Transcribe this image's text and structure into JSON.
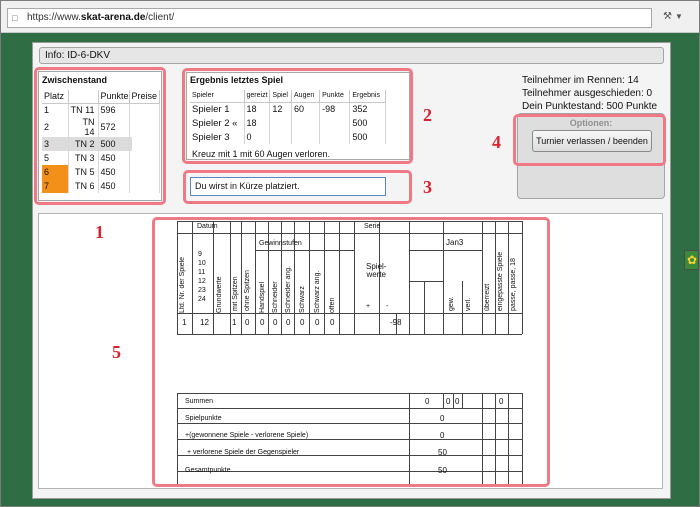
{
  "browser": {
    "url_prefix": "https://www.",
    "url_domain": "skat-arena.de",
    "url_path": "/client/",
    "tool_icon": "tools-icon",
    "dropdown_icon": "chevron-down-icon"
  },
  "info": {
    "label": "Info: ID-6-DKV"
  },
  "zwischenstand": {
    "title": "Zwischenstand",
    "columns": [
      "Platz",
      "",
      "Punkte",
      "Preise"
    ],
    "rows": [
      {
        "platz": "1",
        "name": "TN 11",
        "punkte": "596",
        "preise": ""
      },
      {
        "platz": "2",
        "name": "TN 14",
        "punkte": "572",
        "preise": ""
      },
      {
        "platz": "3",
        "name": "TN 2",
        "punkte": "500",
        "preise": ""
      },
      {
        "platz": "4",
        "name": "TN 4",
        "punkte": "500",
        "preise": ""
      },
      {
        "platz": "5",
        "name": "TN 3",
        "punkte": "450",
        "preise": ""
      },
      {
        "platz": "6",
        "name": "TN 5",
        "punkte": "450",
        "preise": ""
      },
      {
        "platz": "7",
        "name": "TN 6",
        "punkte": "450",
        "preise": ""
      }
    ],
    "highlight_color": "#dcdcdc",
    "orange_color": "#f39019"
  },
  "ergebnis": {
    "title": "Ergebnis letztes Spiel",
    "columns": [
      "Spieler",
      "gereizt",
      "Spiel",
      "Augen",
      "Punkte",
      "Ergebnis"
    ],
    "rows": [
      [
        "Spieler 1",
        "18",
        "12",
        "60",
        "-98",
        "352"
      ],
      [
        "Spieler 2 «",
        "18",
        "",
        "",
        "",
        "500"
      ],
      [
        "Spieler 3",
        "0",
        "",
        "",
        "",
        "500"
      ]
    ],
    "message": "Kreuz mit 1 mit 60 Augen verloren."
  },
  "placement": {
    "value": "Du wirst in Kürze platziert."
  },
  "stats": {
    "line1": "Teilnehmer im Rennen: 14",
    "line2": "Teilnehmer ausgeschieden: 0",
    "line3": "Dein Punktestand: 500 Punkte"
  },
  "options": {
    "title": "Optionen:",
    "button": "Turnier verlassen / beenden"
  },
  "annotations": [
    "1",
    "2",
    "3",
    "4",
    "5"
  ],
  "annotation_color": "#ef7a86",
  "sheet": {
    "datum": "Datum",
    "serie": "Serie",
    "lfd": "Lfd. Nr. der Spiele",
    "grundwerte": [
      "9",
      "10",
      "11",
      "12",
      "23",
      "24"
    ],
    "grundwerte_label": "Grundwerte",
    "mit_spitzen": "mit Spitzen",
    "ohne_spitzen": "ohne Spitzen",
    "gewinnstufen": "Gewinnstufen",
    "stufen": [
      "Handspiel",
      "Schneider",
      "Schneider ang.",
      "Schwarz",
      "Schwarz ang.",
      "offen"
    ],
    "spielwerte": "Spiel-\nwerte",
    "plus": "+",
    "minus": "-",
    "player": "Jan3",
    "gew": "gew.",
    "verl": "verl.",
    "ueberreizt": "überreizt",
    "eingepasst": "eingepasste Spiele",
    "passe": "passe, passe, 18",
    "row": {
      "nr": "1",
      "grund": "12",
      "mit": "1",
      "ohne": "0",
      "stufen": [
        "0",
        "0",
        "0",
        "0",
        "0",
        "0"
      ],
      "minus": "-98"
    },
    "summen_label": "Summen",
    "summen_vals": [
      "0",
      "0",
      "0",
      "0"
    ],
    "spielpunkte": "Spielpunkte",
    "spielpunkte_val": "0",
    "gewonnen": "+(gewonnene Spiele - verlorene Spiele)",
    "gewonnen_val": "0",
    "verlorene": "+ verlorene Spiele der Gegenspieler",
    "verlorene_val": "50",
    "gesamt": "Gesamtpunkte",
    "gesamt_val": "50"
  }
}
